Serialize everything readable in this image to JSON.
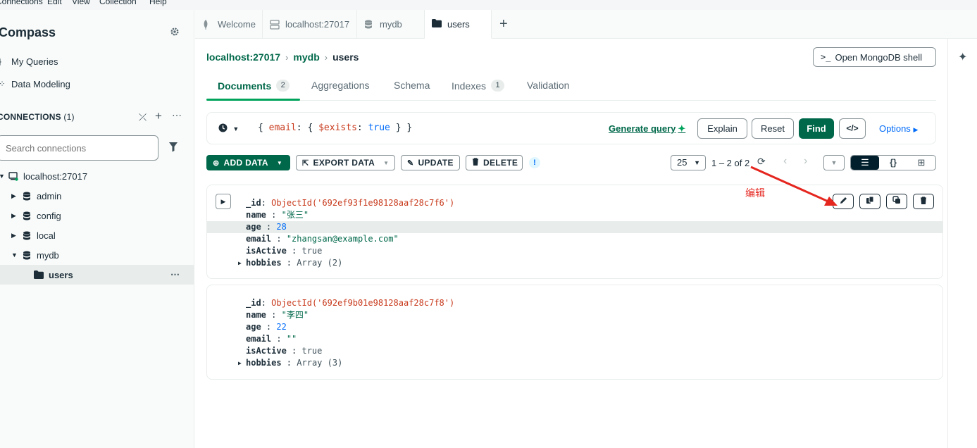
{
  "menubar": {
    "items": [
      "Connections",
      "Edit",
      "View",
      "Collection",
      "Help"
    ]
  },
  "sidebar": {
    "app_name": "Compass",
    "nav": [
      {
        "label": "My Queries",
        "icon": "queries-icon"
      },
      {
        "label": "Data Modeling",
        "icon": "data-modeling-icon"
      }
    ],
    "connections_title": "CONNECTIONS",
    "connections_count": "(1)",
    "search_placeholder": "Search connections",
    "tree": {
      "connection": "localhost:27017",
      "databases": [
        "admin",
        "config",
        "local",
        "mydb"
      ],
      "collection": "users"
    }
  },
  "workspace_tabs": [
    {
      "label": "Welcome",
      "icon": "leaf-icon",
      "active": false
    },
    {
      "label": "localhost:27017",
      "icon": "server-icon",
      "active": false
    },
    {
      "label": "mydb",
      "icon": "database-icon",
      "active": false
    },
    {
      "label": "users",
      "icon": "folder-icon",
      "active": true
    }
  ],
  "breadcrumbs": {
    "connection": "localhost:27017",
    "database": "mydb",
    "collection": "users"
  },
  "shell_button": {
    "prefix": ">_",
    "label": "Open MongoDB shell"
  },
  "collection_tabs": [
    {
      "label": "Documents",
      "count": "2",
      "active": true
    },
    {
      "label": "Aggregations",
      "count": null,
      "active": false
    },
    {
      "label": "Schema",
      "count": null,
      "active": false
    },
    {
      "label": "Indexes",
      "count": "1",
      "active": false
    },
    {
      "label": "Validation",
      "count": null,
      "active": false
    }
  ],
  "query_bar": {
    "filter_open": "{",
    "filter_key": "email",
    "filter_colon": ":",
    "filter_inner_open": "{",
    "filter_op": "$exists",
    "filter_colon2": ":",
    "filter_value": "true",
    "filter_inner_close": "}",
    "filter_close": "}",
    "generate_query": "Generate query",
    "explain": "Explain",
    "reset": "Reset",
    "find": "Find",
    "options": "Options"
  },
  "toolbar": {
    "add_data": "ADD DATA",
    "export_data": "EXPORT DATA",
    "update": "UPDATE",
    "delete": "DELETE",
    "page_size": "25",
    "range": "1 – 2 of 2"
  },
  "documents": [
    {
      "_id": "ObjectId('692ef93f1e98128aaf28c7f6')",
      "name": "\"张三\"",
      "age": "28",
      "email": "\"zhangsan@example.com\"",
      "isActive": "true",
      "hobbies": "Array (2)"
    },
    {
      "_id": "ObjectId('692ef9b01e98128aaf28c7f8')",
      "name": "\"李四\"",
      "age": "22",
      "email": "\"\"",
      "isActive": "true",
      "hobbies": "Array (3)"
    }
  ],
  "field_labels": {
    "id": "_id",
    "name": "name",
    "age": "age",
    "email": "email",
    "isActive": "isActive",
    "hobbies": "hobbies"
  },
  "annotation": {
    "text": "编辑",
    "color": "#e5261f"
  },
  "colors": {
    "brand_green": "#00684a",
    "accent_green": "#00a35c",
    "link_blue": "#016bf8",
    "oid_red": "#c83a1c"
  }
}
